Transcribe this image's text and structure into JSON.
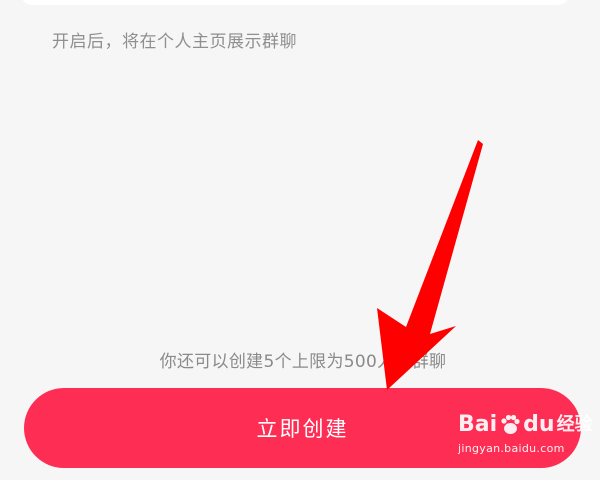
{
  "hint_text": "开启后，将在个人主页展示群聊",
  "remaining_text": "你还可以创建5个上限为500人的群聊",
  "create_button": {
    "label": "立即创建"
  },
  "annotation": {
    "arrow_color": "#ff0000"
  },
  "watermark": {
    "brand_prefix": "Bai",
    "brand_suffix": "du",
    "brand_cn": "经验",
    "url": "jingyan.baidu.com"
  },
  "colors": {
    "accent": "#fd2d54",
    "background": "#f6f6f6",
    "hint_text": "#8f8f8f"
  }
}
